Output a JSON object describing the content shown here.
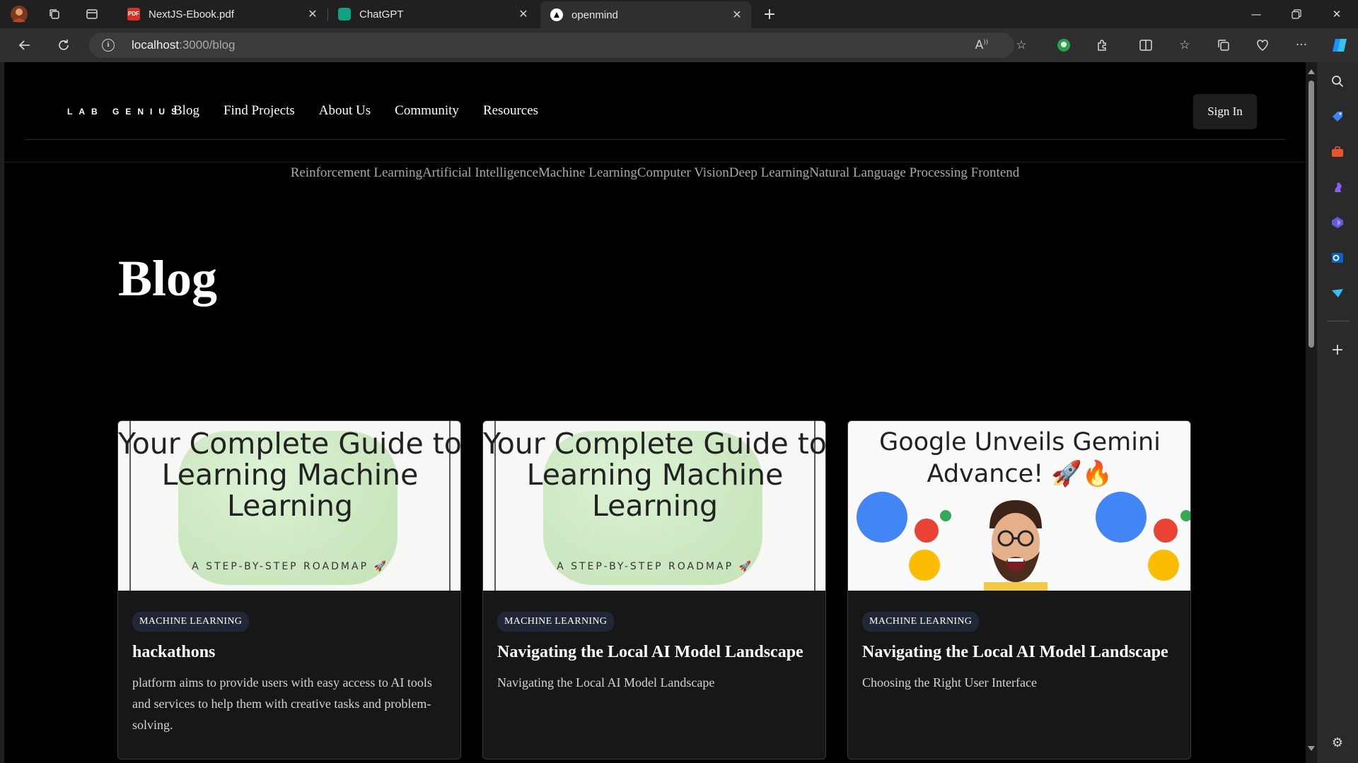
{
  "browser": {
    "tabs": [
      {
        "title": "NextJS-Ebook.pdf",
        "icon": "pdf-icon"
      },
      {
        "title": "ChatGPT",
        "icon": "chatgpt-icon"
      },
      {
        "title": "openmind",
        "icon": "openmind-icon",
        "active": true
      }
    ],
    "url_host": "localhost",
    "url_path": ":3000/blog"
  },
  "site": {
    "brand": "LAB GENIUS",
    "nav": [
      "Blog",
      "Find Projects",
      "About Us",
      "Community",
      "Resources"
    ],
    "sign_in": "Sign In",
    "categories": [
      "Reinforcement Learning",
      "Artificial Intelligence",
      "Machine Learning",
      "Computer Vision",
      "Deep Learning",
      "Natural Language Processing",
      " Frontend"
    ]
  },
  "page": {
    "title": "Blog"
  },
  "posts": [
    {
      "image_title": "Your Complete Guide to Learning Machine Learning",
      "image_subtitle": "A STEP-BY-STEP ROADMAP 🚀",
      "tag": "MACHINE LEARNING",
      "title": "hackathons",
      "description": "platform aims to provide users with easy access to AI tools and services to help them with creative tasks and problem-solving."
    },
    {
      "image_title": "Your Complete Guide to Learning Machine Learning",
      "image_subtitle": "A STEP-BY-STEP ROADMAP 🚀",
      "tag": "MACHINE LEARNING",
      "title": "Navigating the Local AI Model Landscape",
      "description": "Navigating the Local AI Model Landscape"
    },
    {
      "image_title": "Google Unveils Gemini Advance! 🚀🔥",
      "tag": "MACHINE LEARNING",
      "title": "Navigating the Local AI Model Landscape",
      "description": "Choosing the Right User Interface"
    }
  ],
  "colors": {
    "page_bg": "#000000",
    "card_bg": "#171717",
    "tag_bg": "#202736",
    "chrome_bg": "#202020"
  }
}
